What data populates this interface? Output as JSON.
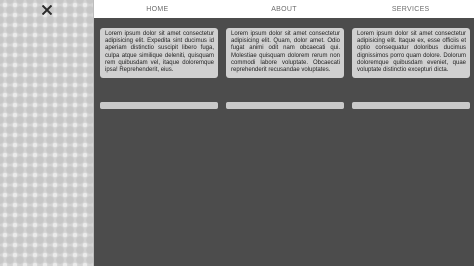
{
  "sidebar": {
    "close_icon": "close-icon"
  },
  "nav": {
    "items": [
      {
        "label": "HOME"
      },
      {
        "label": "ABOUT"
      },
      {
        "label": "SERVICES"
      }
    ]
  },
  "cards": [
    {
      "text": "Lorem ipsum dolor sit amet consectetur adipisicing elit. Expedita sint ducimus id aperiam distinctio suscipit libero fuga, culpa atque similique deleniti, quisquam rem quibusdam vel, itaque doloremque ipsa! Reprehenderit, eius."
    },
    {
      "text": "Lorem ipsum dolor sit amet consectetur adipisicing elit. Quam, dolor amet. Odio fugat animi odit nam obcaecati qui. Molestiae quisquam dolorem rerum non commodi labore voluptate. Obcaecati reprehenderit recusandae voluptates."
    },
    {
      "text": "Lorem ipsum dolor sit amet consectetur adipisicing elit. Itaque ex, esse officiis et optio consequatur doloribus ducimus dignissimos porro quam dolore. Dolorum doloremque quibusdam eveniet, quae voluptate distinctio excepturi dicta."
    }
  ]
}
